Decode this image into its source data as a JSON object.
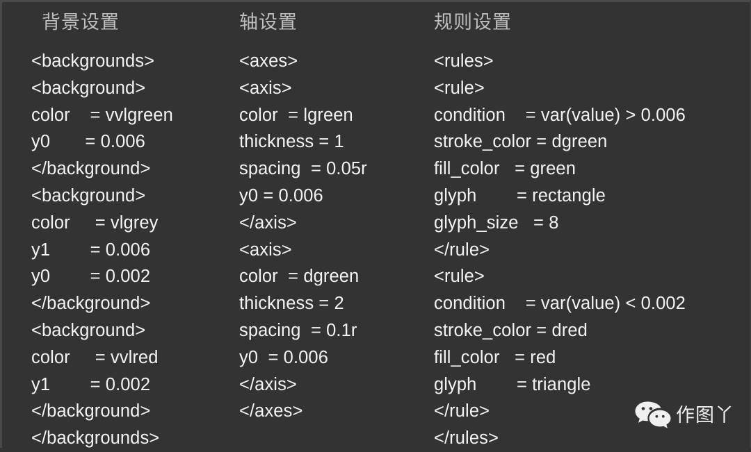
{
  "theme": {
    "background_color": "#333333",
    "text_color": "#f2f2f2",
    "heading_color": "#bdbdbd"
  },
  "columns": [
    {
      "id": "backgrounds",
      "title": "背景设置",
      "lines": [
        "<backgrounds>",
        "<background>",
        "color    = vvlgreen",
        "y0       = 0.006",
        "</background>",
        "<background>",
        "color     = vlgrey",
        "y1        = 0.006",
        "y0        = 0.002",
        "</background>",
        "<background>",
        "color     = vvlred",
        "y1        = 0.002",
        "</background>",
        "</backgrounds>"
      ]
    },
    {
      "id": "axes",
      "title": "轴设置",
      "lines": [
        "<axes>",
        "<axis>",
        "color  = lgreen",
        "thickness = 1",
        "spacing  = 0.05r",
        "y0 = 0.006",
        "</axis>",
        "<axis>",
        "color  = dgreen",
        "thickness = 2",
        "spacing  = 0.1r",
        "y0  = 0.006",
        "</axis>",
        "</axes>"
      ]
    },
    {
      "id": "rules",
      "title": "规则设置",
      "lines": [
        "<rules>",
        "<rule>",
        "condition    = var(value) > 0.006",
        "stroke_color = dgreen",
        "fill_color   = green",
        "glyph        = rectangle",
        "glyph_size   = 8",
        "</rule>",
        "<rule>",
        "condition    = var(value) < 0.002",
        "stroke_color = dred",
        "fill_color   = red",
        "glyph        = triangle",
        "</rule>",
        "</rules>"
      ]
    }
  ],
  "watermark": {
    "icon": "wechat-logo-icon",
    "text": "作图丫"
  }
}
